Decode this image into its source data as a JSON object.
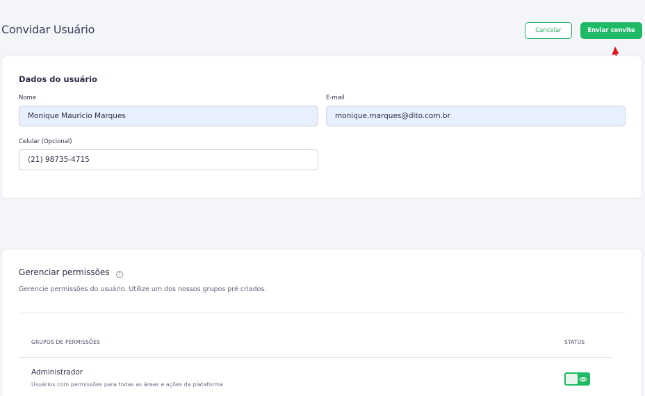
{
  "header": {
    "title": "Convidar Usuário",
    "cancel_label": "Cancelar",
    "send_label": "Enviar convite"
  },
  "user_form": {
    "section_title": "Dados do usuário",
    "name_label": "Nome",
    "name_value": "Monique Mauricio Marques",
    "email_label": "E-mail",
    "email_value": "monique.marques@dito.com.br",
    "phone_label": "Celular (Opcional)",
    "phone_value": "(21) 98735-4715"
  },
  "permissions": {
    "title": "Gerenciar permissões",
    "help_icon": "?",
    "description": "Gerencie permissões do usuário. Utilize um dos nossos grupos pré criados.",
    "col_groups": "GRUPOS DE PERMISSÕES",
    "col_status": "STATUS",
    "rows": [
      {
        "name": "Administrador",
        "description": "Usuários com permissões para todas as áreas e ações da plataforma",
        "status_on": true
      }
    ]
  },
  "colors": {
    "accent": "#1fba66",
    "annotation_arrow": "#e8101c"
  },
  "icons": {
    "help": "help-circle-icon",
    "status": "eye-icon",
    "annotation": "arrow-icon"
  }
}
